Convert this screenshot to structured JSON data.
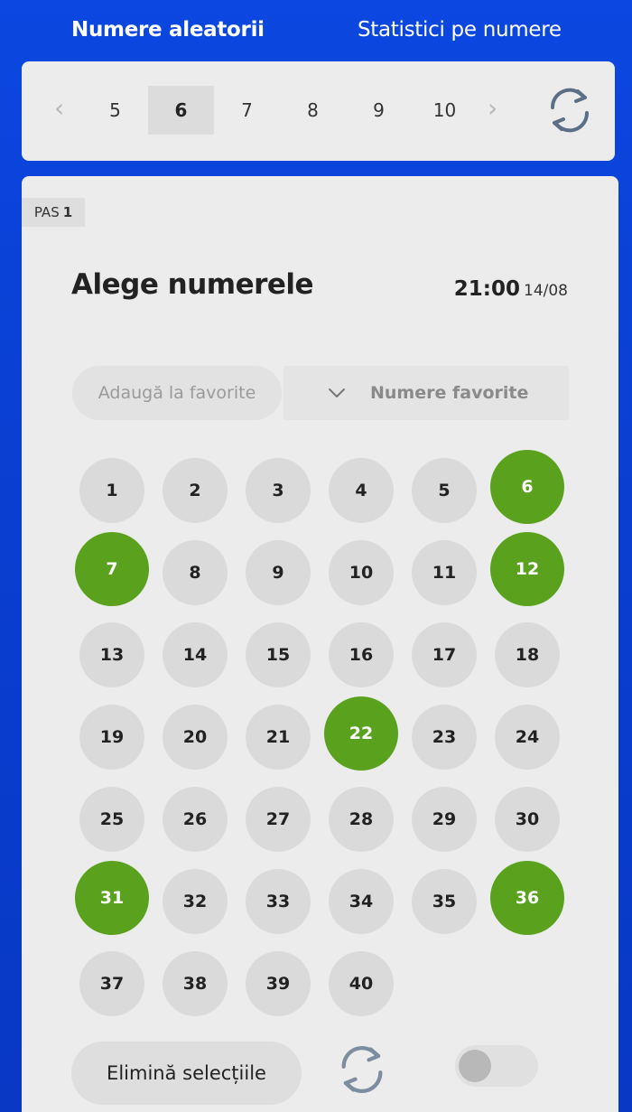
{
  "tabs": {
    "random": "Numere aleatorii",
    "stats": "Statistici pe numere"
  },
  "draw_selector": {
    "options": [
      "5",
      "6",
      "7",
      "8",
      "9",
      "10"
    ],
    "selected": "6"
  },
  "step": {
    "label": "PAS",
    "number": "1"
  },
  "title": "Alege numerele",
  "draw_time": {
    "time": "21:00",
    "date": "14/08"
  },
  "favorites": {
    "add_label": "Adaugă la favorite",
    "select_label": "Numere favorite"
  },
  "numbers": [
    "1",
    "2",
    "3",
    "4",
    "5",
    "6",
    "7",
    "8",
    "9",
    "10",
    "11",
    "12",
    "13",
    "14",
    "15",
    "16",
    "17",
    "18",
    "19",
    "20",
    "21",
    "22",
    "23",
    "24",
    "25",
    "26",
    "27",
    "28",
    "29",
    "30",
    "31",
    "32",
    "33",
    "34",
    "35",
    "36",
    "37",
    "38",
    "39",
    "40"
  ],
  "selected_numbers": [
    "6",
    "7",
    "12",
    "22",
    "31",
    "36"
  ],
  "actions": {
    "clear_label": "Elimină selecțiile"
  },
  "colors": {
    "background": "#0a3fd2",
    "selected_ball": "#5aa21e",
    "ball": "#dadada",
    "card": "#ececec"
  },
  "icons": {
    "prev": "chevron-left-icon",
    "next": "chevron-right-icon",
    "refresh": "refresh-icon",
    "dropdown": "chevron-down-icon"
  },
  "toggle": {
    "on": false
  }
}
